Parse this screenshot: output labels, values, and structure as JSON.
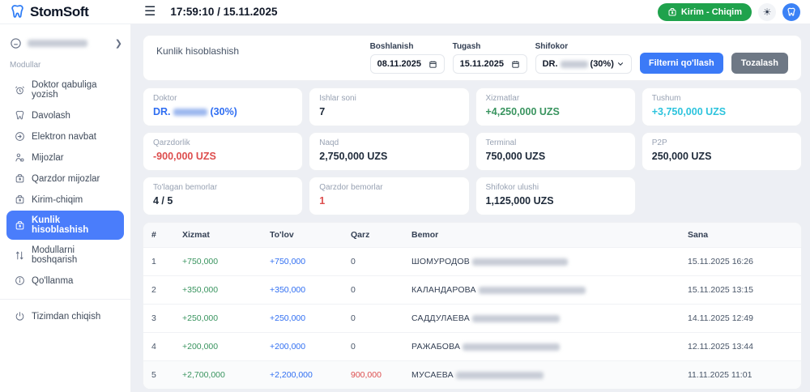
{
  "topbar": {
    "logo": "StomSoft",
    "datetime": "17:59:10 / 15.11.2025",
    "kirim_chiqim_button": "Kirim - Chiqim"
  },
  "sidebar": {
    "section_label": "Modullar",
    "items": [
      {
        "label": "Doktor qabuliga yozish",
        "icon": "alarm-clock-icon"
      },
      {
        "label": "Davolash",
        "icon": "tooth-icon"
      },
      {
        "label": "Elektron navbat",
        "icon": "arrow-right-circle-icon"
      },
      {
        "label": "Mijozlar",
        "icon": "users-icon"
      },
      {
        "label": "Qarzdor mijozlar",
        "icon": "money-bag-icon"
      },
      {
        "label": "Kirim-chiqim",
        "icon": "money-bag-icon"
      },
      {
        "label": "Kunlik hisoblashish",
        "icon": "money-bag-icon",
        "active": true
      },
      {
        "label": "Modullarni boshqarish",
        "icon": "sliders-icon"
      },
      {
        "label": "Qo'llanma",
        "icon": "info-icon"
      }
    ],
    "logout": "Tizimdan chiqish"
  },
  "filters": {
    "title": "Kunlik hisoblashish",
    "boshlanish_label": "Boshlanish",
    "boshlanish_value": "08.11.2025",
    "tugash_label": "Tugash",
    "tugash_value": "15.11.2025",
    "shifokor_label": "Shifokor",
    "shifokor_prefix": "DR.",
    "shifokor_suffix": "(30%)",
    "apply_button": "Filterni qo'llash",
    "clear_button": "Tozalash"
  },
  "stats": [
    {
      "label": "Doktor",
      "prefix": "DR.",
      "suffix": "(30%)",
      "color": "#2f6ef2"
    },
    {
      "label": "Ishlar soni",
      "value": "7"
    },
    {
      "label": "Xizmatlar",
      "value": "+4,250,000 UZS",
      "color": "#39945f"
    },
    {
      "label": "Tushum",
      "value": "+3,750,000 UZS",
      "color": "#2cc3dd"
    },
    {
      "label": "Qarzdorlik",
      "value": "-900,000 UZS",
      "color": "#dd4d4d"
    },
    {
      "label": "Naqd",
      "value": "2,750,000 UZS"
    },
    {
      "label": "Terminal",
      "value": "750,000 UZS"
    },
    {
      "label": "P2P",
      "value": "250,000 UZS"
    },
    {
      "label": "To'lagan bemorlar",
      "value": "4 / 5"
    },
    {
      "label": "Qarzdor bemorlar",
      "value": "1",
      "color": "#dd4d4d"
    },
    {
      "label": "Shifokor ulushi",
      "value": "1,125,000 UZS"
    }
  ],
  "table": {
    "headers": [
      "#",
      "Xizmat",
      "To'lov",
      "Qarz",
      "Bemor",
      "Sana"
    ],
    "rows": [
      {
        "num": "1",
        "xizmat": "+750,000",
        "tolov": "+750,000",
        "qarz": "0",
        "bemor": "ШОМУРОДОВ",
        "sana": "15.11.2025 16:26"
      },
      {
        "num": "2",
        "xizmat": "+350,000",
        "tolov": "+350,000",
        "qarz": "0",
        "bemor": "КАЛАНДАРОВА",
        "sana": "15.11.2025 13:15"
      },
      {
        "num": "3",
        "xizmat": "+250,000",
        "tolov": "+250,000",
        "qarz": "0",
        "bemor": "САДДУЛАЕВА",
        "sana": "14.11.2025 12:49"
      },
      {
        "num": "4",
        "xizmat": "+200,000",
        "tolov": "+200,000",
        "qarz": "0",
        "bemor": "РАЖАБОВА",
        "sana": "12.11.2025 13:44"
      },
      {
        "num": "5",
        "xizmat": "+2,700,000",
        "tolov": "+2,200,000",
        "qarz": "900,000",
        "bemor": "МУСАЕВА",
        "sana": "11.11.2025 11:01"
      }
    ]
  },
  "colors": {
    "accent_blue": "#3b7af7",
    "sidebar_active": "#4a7dfb",
    "button_green": "#1fa24c",
    "value_green": "#39945f",
    "value_cyan": "#2cc3dd",
    "value_red": "#dd4d4d"
  }
}
